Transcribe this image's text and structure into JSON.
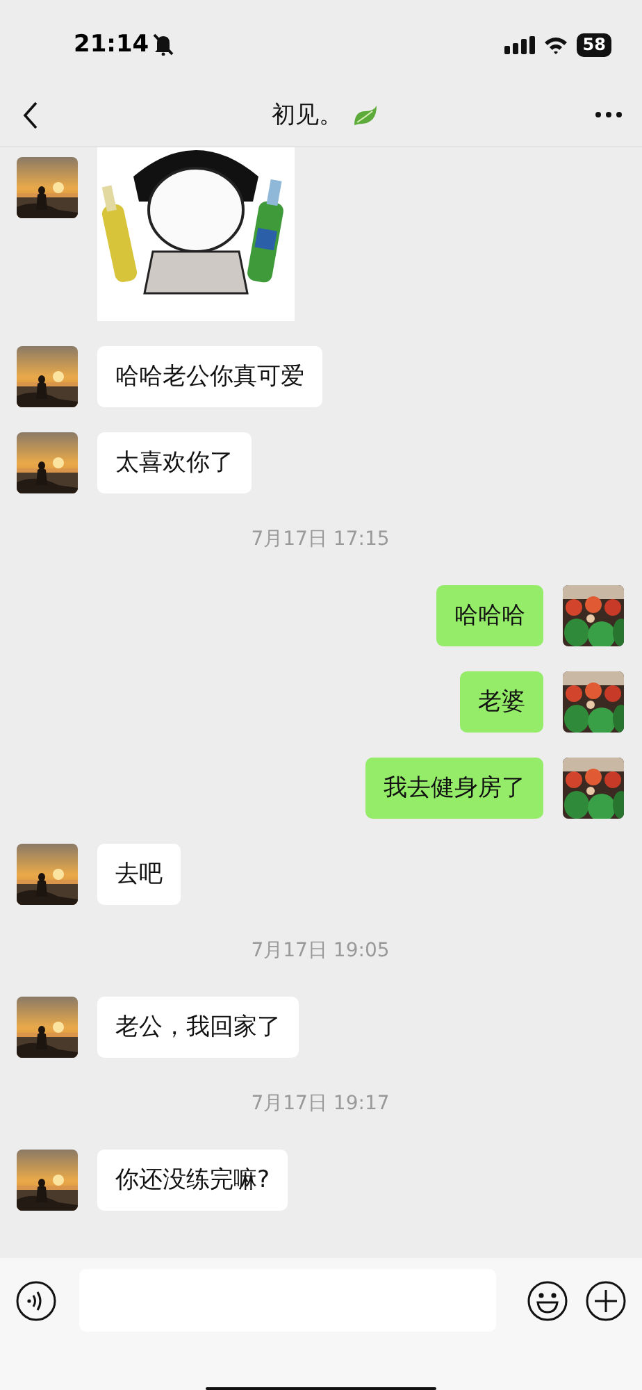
{
  "status_bar": {
    "time": "21:14",
    "battery": "58"
  },
  "header": {
    "title": "初见。"
  },
  "messages": [
    {
      "kind": "sticker",
      "outgoing": false
    },
    {
      "kind": "text",
      "outgoing": false,
      "text": "哈哈老公你真可爱"
    },
    {
      "kind": "text",
      "outgoing": false,
      "text": "太喜欢你了"
    },
    {
      "kind": "time",
      "text": "7月17日 17:15"
    },
    {
      "kind": "text",
      "outgoing": true,
      "text": "哈哈哈"
    },
    {
      "kind": "text",
      "outgoing": true,
      "text": "老婆"
    },
    {
      "kind": "text",
      "outgoing": true,
      "text": "我去健身房了"
    },
    {
      "kind": "text",
      "outgoing": false,
      "text": "去吧"
    },
    {
      "kind": "time",
      "text": "7月17日 19:05"
    },
    {
      "kind": "text",
      "outgoing": false,
      "text": "老公，我回家了"
    },
    {
      "kind": "time",
      "text": "7月17日 19:17"
    },
    {
      "kind": "text",
      "outgoing": false,
      "text": "你还没练完嘛?"
    }
  ]
}
